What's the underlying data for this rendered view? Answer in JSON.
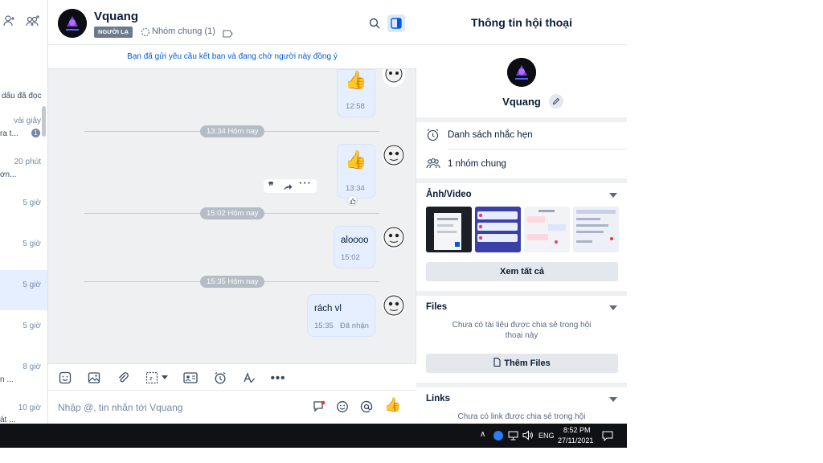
{
  "left_panel": {
    "items": [
      {
        "label": "dấu đã đọc",
        "time": ""
      },
      {
        "label": "ra t...",
        "time": "vài giây",
        "unread": "1"
      },
      {
        "label": "ơn...",
        "time": "20 phút"
      },
      {
        "label": "",
        "time": "5 giờ"
      },
      {
        "label": "",
        "time": "5 giờ"
      },
      {
        "label": "",
        "time": "5 giờ"
      },
      {
        "label": "",
        "time": "5 giờ"
      },
      {
        "label": "n ...",
        "time": "8 giờ"
      },
      {
        "label": "át ...",
        "time": "10 giờ"
      }
    ]
  },
  "header": {
    "name": "Vquang",
    "badge": "NGƯỜI LẠ",
    "groups": "Nhóm chung (1)"
  },
  "notice": "Bạn đã gửi yêu cầu kết bạn và đang chờ người này đồng ý",
  "messages": {
    "m1_time": "12:58",
    "d1": "13:34 Hôm nay",
    "m2_time": "13:34",
    "d2": "15:02 Hôm nay",
    "m3_text": "aloooo",
    "m3_time": "15:02",
    "d3": "15:35 Hôm nay",
    "m4_text": "rách vl",
    "m4_time": "15:35",
    "m4_status": "Đã nhận"
  },
  "composer": {
    "placeholder": "Nhập @, tin nhắn tới Vquang"
  },
  "info_panel": {
    "title": "Thông tin hội thoại",
    "name": "Vquang",
    "reminders": "Danh sách nhắc hẹn",
    "common_groups": "1 nhóm chung",
    "media_title": "Ảnh/Video",
    "see_all": "Xem tất cả",
    "files_title": "Files",
    "files_empty": "Chưa có tài liệu được chia sẻ trong hội thoại này",
    "add_files": "Thêm Files",
    "links_title": "Links",
    "links_empty": "Chưa có link được chia sẻ trong hội"
  },
  "taskbar": {
    "lang": "ENG",
    "time": "8:52 PM",
    "date": "27/11/2021"
  },
  "colors": {
    "accent": "#005ae0",
    "bubble": "#e5efff",
    "chat_bg": "#eef0f1",
    "taskbar": "#101114"
  }
}
